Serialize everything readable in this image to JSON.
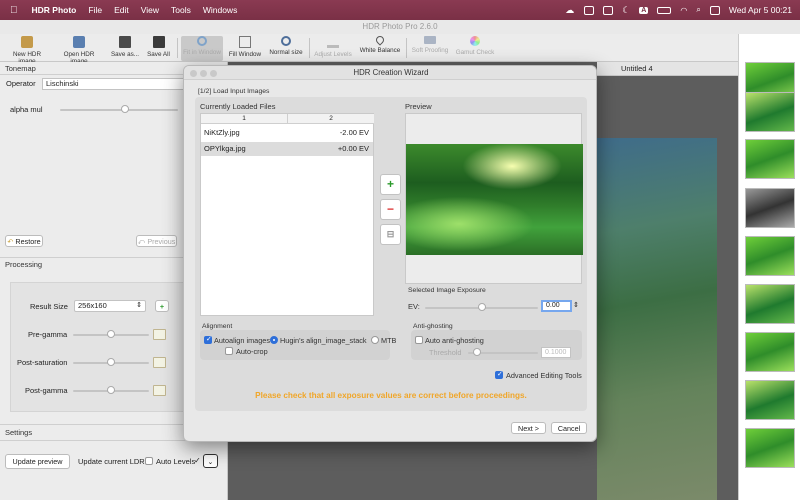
{
  "menubar": {
    "apple": "",
    "app_name": "HDR Photo",
    "menus": [
      "File",
      "Edit",
      "View",
      "Tools",
      "Windows"
    ],
    "clock": "Wed Apr 5  00:21",
    "input_source": "A"
  },
  "window": {
    "title": "HDR Photo Pro 2.6.0"
  },
  "toolbar": {
    "items": [
      {
        "label": "New HDR image"
      },
      {
        "label": "Open HDR image"
      },
      {
        "label": "Save as..."
      },
      {
        "label": "Save All"
      },
      {
        "label": "Fit in Window"
      },
      {
        "label": "Fill Window"
      },
      {
        "label": "Normal size"
      },
      {
        "label": "Adjust Levels"
      },
      {
        "label": "White Balance"
      },
      {
        "label": "Soft Proofing"
      },
      {
        "label": "Gamut Check"
      }
    ]
  },
  "tabs": {
    "active": "Untitled 4"
  },
  "tonemap": {
    "title": "Tonemap",
    "operator_label": "Operator",
    "operator_value": "Lischinski",
    "alpha_label": "alpha mul",
    "alpha_fraction": 0.55,
    "restore_label": "Restore",
    "previous_label": "Previous"
  },
  "processing": {
    "title": "Processing",
    "result_size_label": "Result Size",
    "result_size_value": "256x160",
    "pregamma_label": "Pre-gamma",
    "postsat_label": "Post-saturation",
    "postgamma_label": "Post-gamma",
    "pregamma_fraction": 0.5,
    "postsat_fraction": 0.5,
    "postgamma_fraction": 0.5
  },
  "settings": {
    "title": "Settings",
    "update_preview": "Update preview",
    "update_current_ldr": "Update current LDR",
    "auto_levels": "Auto Levels",
    "auto_levels_checked": false
  },
  "dialog": {
    "title": "HDR Creation Wizard",
    "step": "[1/2] Load Input Images",
    "files_title": "Currently Loaded Files",
    "col1": "1",
    "col2": "2",
    "files": [
      {
        "name": "NiKtZly.jpg",
        "ev": "-2.00 EV"
      },
      {
        "name": "OPYlkga.jpg",
        "ev": "+0.00 EV"
      }
    ],
    "preview_title": "Preview",
    "exposure_title": "Selected Image Exposure",
    "ev_label": "EV:",
    "ev_value": "0.00",
    "ev_fraction": 0.5,
    "alignment_title": "Alignment",
    "autoalign_label": "Autoalign images",
    "autoalign_checked": true,
    "hugin_label": "Hugin's align_image_stack",
    "mtb_label": "MTB",
    "autocrop_label": "Auto-crop",
    "antighost_title": "Anti-ghosting",
    "auto_antighost_label": "Auto anti-ghosting",
    "threshold_label": "Threshold",
    "threshold_value": "0.1000",
    "advanced_label": "Advanced Editing Tools",
    "advanced_checked": true,
    "warning": "Please check that all exposure values are correct before proceedings.",
    "next_label": "Next >",
    "cancel_label": "Cancel"
  }
}
